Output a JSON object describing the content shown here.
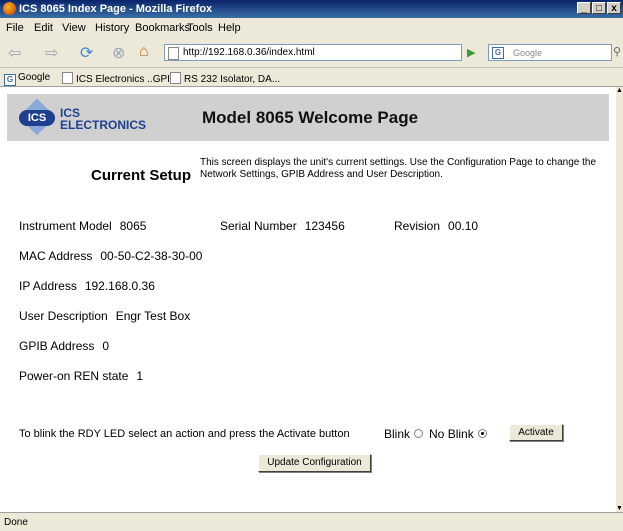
{
  "window": {
    "title": "ICS 8065 Index Page - Mozilla Firefox",
    "min": "_",
    "max": "□",
    "close": "x"
  },
  "menu": [
    "File",
    "Edit",
    "View",
    "History",
    "Bookmarks",
    "Tools",
    "Help"
  ],
  "toolbar": {
    "url": "http://192.168.0.36/index.html",
    "search_placeholder": "Google"
  },
  "bookmarks": [
    "Google",
    "ICS Electronics ..GPI...",
    "RS 232 Isolator, DA..."
  ],
  "page": {
    "logo": "ICS",
    "brand_line1": "ICS",
    "brand_line2": "ELECTRONICS",
    "welcome": "Model 8065 Welcome Page",
    "current_setup": "Current Setup",
    "description": "This screen displays the unit's current settings. Use the Configuration Page to change the Network Settings, GPIB Address and User Description.",
    "instrument_model_label": "Instrument Model",
    "instrument_model_value": "8065",
    "serial_label": "Serial Number",
    "serial_value": "123456",
    "revision_label": "Revision",
    "revision_value": "00.10",
    "mac_label": "MAC Address",
    "mac_value": "00-50-C2-38-30-00",
    "ip_label": "IP Address",
    "ip_value": "192.168.0.36",
    "user_desc_label": "User Description",
    "user_desc_value": "Engr Test Box",
    "gpib_label": "GPIB Address",
    "gpib_value": "0",
    "ren_label": "Power-on REN state",
    "ren_value": "1",
    "blink_instruction": "To blink the RDY LED select an action and press the Activate button",
    "blink_label": "Blink",
    "no_blink_label": "No Blink",
    "blink_selected": "No Blink",
    "activate_button": "Activate",
    "update_button": "Update Configuration"
  },
  "status": "Done"
}
